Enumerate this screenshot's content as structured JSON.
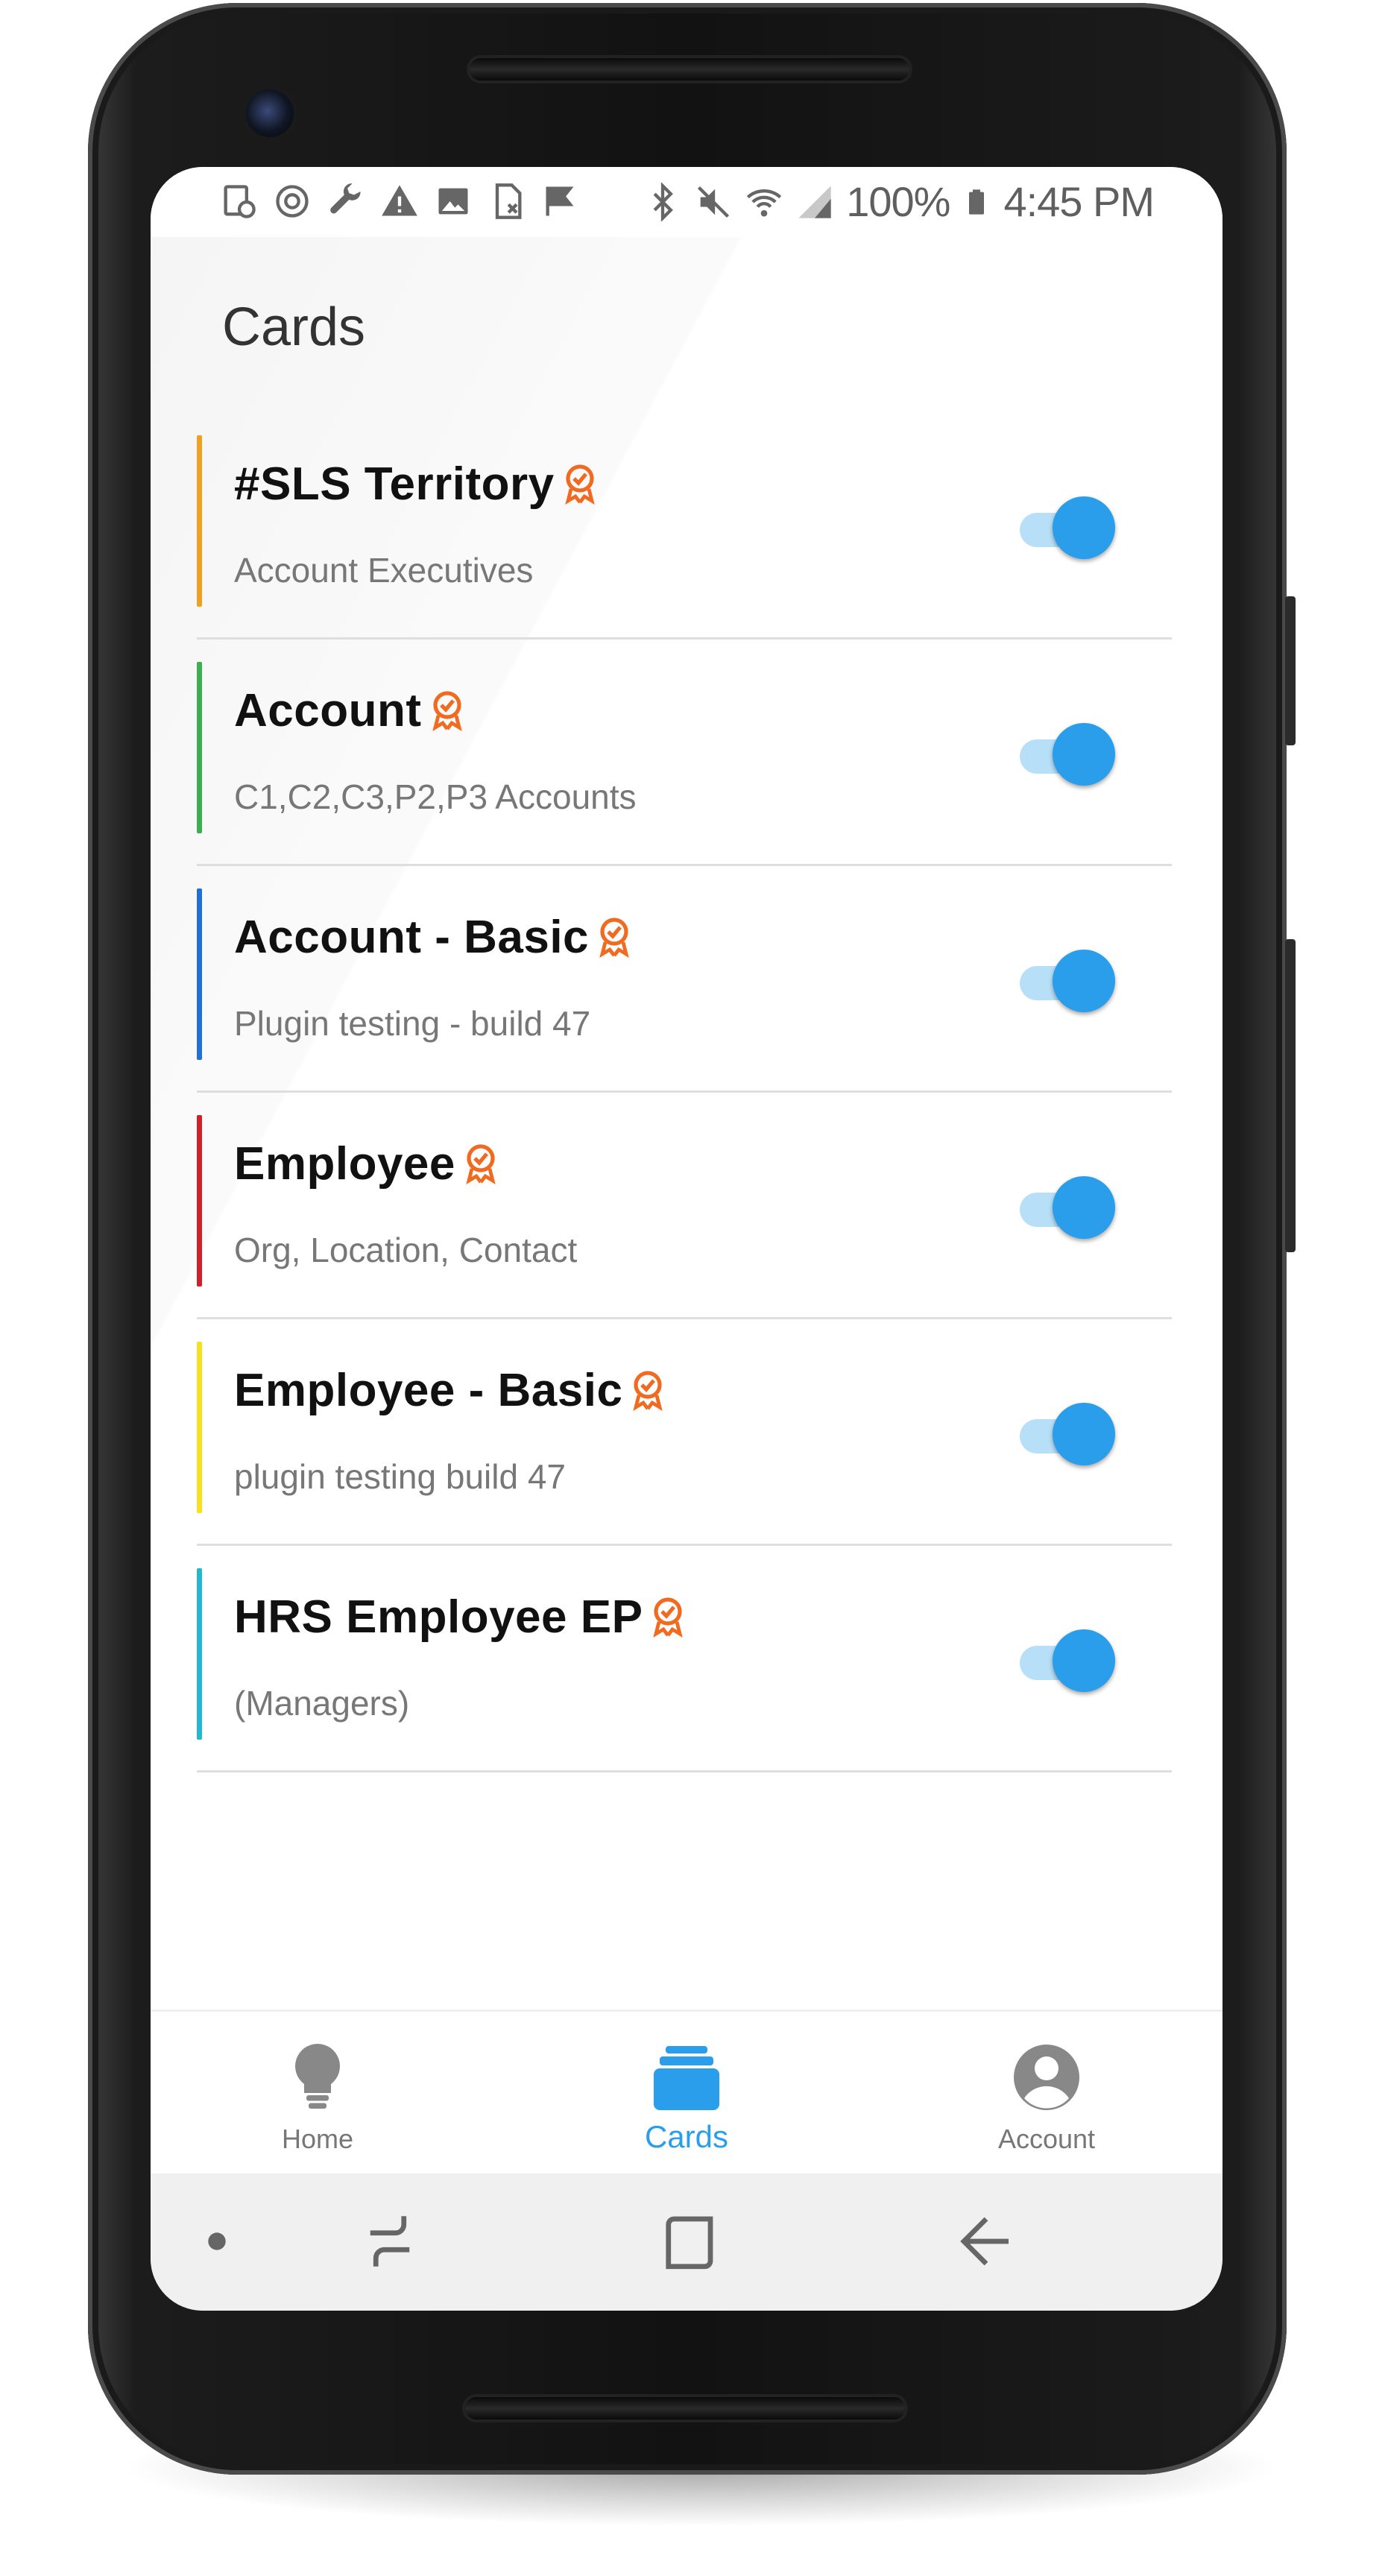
{
  "status_bar": {
    "battery_percent": "100%",
    "time": "4:45 PM",
    "left_icons": [
      "card-settings-icon",
      "sync-icon",
      "wrench-icon",
      "warning-icon",
      "image-icon",
      "sim-icon",
      "flag-icon"
    ],
    "right_icons": [
      "bluetooth-icon",
      "mute-icon",
      "wifi-icon",
      "signal-icon",
      "battery-icon"
    ]
  },
  "page": {
    "title": "Cards"
  },
  "cards": [
    {
      "title": "#SLS Territory",
      "subtitle": "Account Executives",
      "accent": "#f0a020",
      "enabled": true
    },
    {
      "title": "Account",
      "subtitle": "C1,C2,C3,P2,P3 Accounts",
      "accent": "#3cb050",
      "enabled": true
    },
    {
      "title": "Account - Basic",
      "subtitle": "Plugin testing - build 47",
      "accent": "#2070d8",
      "enabled": true
    },
    {
      "title": "Employee",
      "subtitle": "Org, Location, Contact",
      "accent": "#d0202a",
      "enabled": true
    },
    {
      "title": "Employee - Basic",
      "subtitle": "plugin testing build 47",
      "accent": "#f6e020",
      "enabled": true
    },
    {
      "title": "HRS Employee EP",
      "subtitle": "(Managers)",
      "accent": "#22b8d0",
      "enabled": true
    }
  ],
  "tabs": [
    {
      "label": "Home",
      "icon": "lightbulb-icon",
      "active": false
    },
    {
      "label": "Cards",
      "icon": "cards-stack-icon",
      "active": true
    },
    {
      "label": "Account",
      "icon": "account-circle-icon",
      "active": false
    }
  ],
  "colors": {
    "accent_blue": "#2a9eea",
    "badge_orange": "#f06a20",
    "toggle_track": "#b7dff8"
  }
}
